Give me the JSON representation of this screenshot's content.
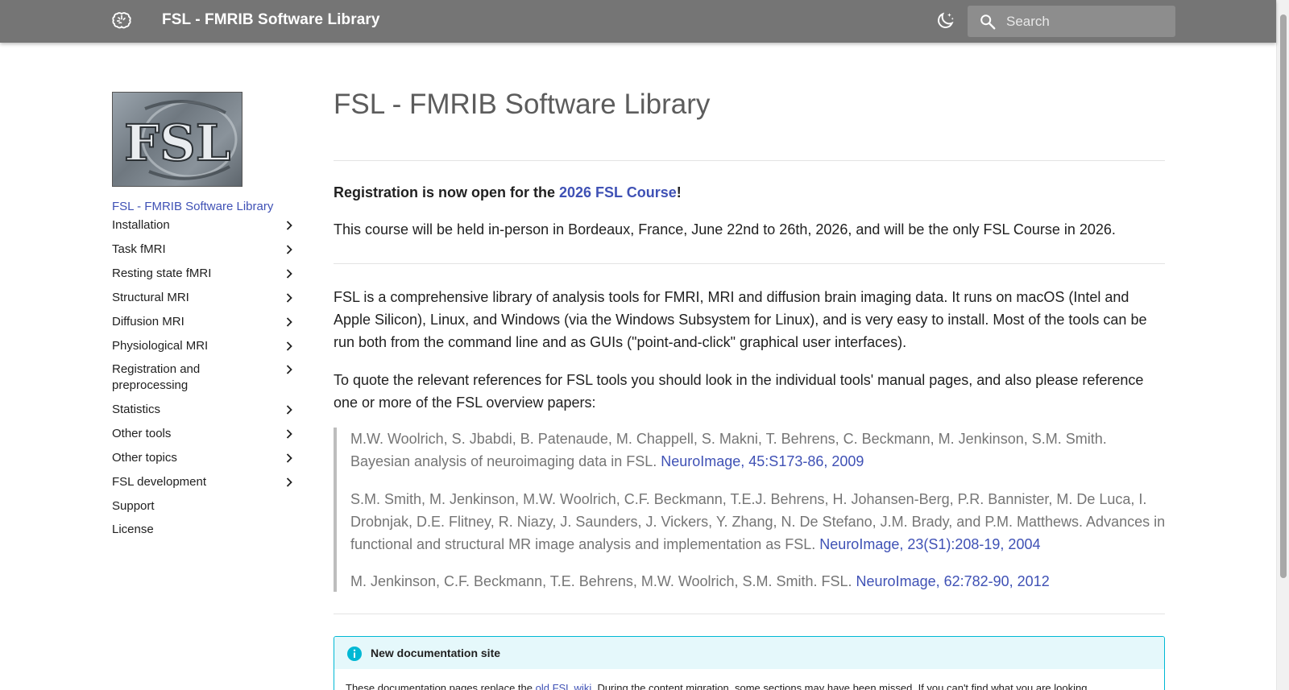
{
  "header": {
    "logo_icon": "brain-icon",
    "title": "FSL - FMRIB Software Library",
    "theme_toggle_icon": "moon-stars-icon",
    "search_icon": "magnify-icon",
    "search_placeholder": "Search",
    "colors": {
      "bar": "#757575",
      "accent": "#3f51b5"
    }
  },
  "sidebar": {
    "logo_text": "FSL",
    "home_link": "FSL - FMRIB Software Library",
    "items": [
      {
        "label": "Installation",
        "has_children": true
      },
      {
        "label": "Task fMRI",
        "has_children": true
      },
      {
        "label": "Resting state fMRI",
        "has_children": true
      },
      {
        "label": "Structural MRI",
        "has_children": true
      },
      {
        "label": "Diffusion MRI",
        "has_children": true
      },
      {
        "label": "Physiological MRI",
        "has_children": true
      },
      {
        "label": "Registration and preprocessing",
        "has_children": true
      },
      {
        "label": "Statistics",
        "has_children": true
      },
      {
        "label": "Other tools",
        "has_children": true
      },
      {
        "label": "Other topics",
        "has_children": true
      },
      {
        "label": "FSL development",
        "has_children": true
      },
      {
        "label": "Support",
        "has_children": false
      },
      {
        "label": "License",
        "has_children": false
      }
    ]
  },
  "main": {
    "title": "FSL - FMRIB Software Library",
    "announcement": {
      "prefix": "Registration is now open for the ",
      "link": "2026 FSL Course",
      "suffix": "!"
    },
    "course_info": "This course will be held in-person in Bordeaux, France, June 22nd to 26th, 2026, and will be the only FSL Course in 2026.",
    "intro": "FSL is a comprehensive library of analysis tools for FMRI, MRI and diffusion brain imaging data. It runs on macOS (Intel and Apple Silicon), Linux, and Windows (via the Windows Subsystem for Linux), and is very easy to install. Most of the tools can be run both from the command line and as GUIs (\"point-and-click\" graphical user interfaces).",
    "quote_intro": "To quote the relevant references for FSL tools you should look in the individual tools' manual pages, and also please reference one or more of the FSL overview papers:",
    "references": [
      {
        "text": "M.W. Woolrich, S. Jbabdi, B. Patenaude, M. Chappell, S. Makni, T. Behrens, C. Beckmann, M. Jenkinson, S.M. Smith. Bayesian analysis of neuroimaging data in FSL. ",
        "link": "NeuroImage, 45:S173-86, 2009"
      },
      {
        "text": "S.M. Smith, M. Jenkinson, M.W. Woolrich, C.F. Beckmann, T.E.J. Behrens, H. Johansen-Berg, P.R. Bannister, M. De Luca, I. Drobnjak, D.E. Flitney, R. Niazy, J. Saunders, J. Vickers, Y. Zhang, N. De Stefano, J.M. Brady, and P.M. Matthews. Advances in functional and structural MR image analysis and implementation as FSL. ",
        "link": "NeuroImage, 23(S1):208-19, 2004"
      },
      {
        "text": "M. Jenkinson, C.F. Beckmann, T.E. Behrens, M.W. Woolrich, S.M. Smith. FSL. ",
        "link": "NeuroImage, 62:782-90, 2012"
      }
    ],
    "admonition": {
      "icon": "info-circle-icon",
      "title": "New documentation site",
      "body_prefix": "These documentation pages replace the ",
      "body_link": "old FSL wiki",
      "body_suffix": ". During the content migration, some sections may have been missed. If you can't find what you are looking"
    }
  }
}
